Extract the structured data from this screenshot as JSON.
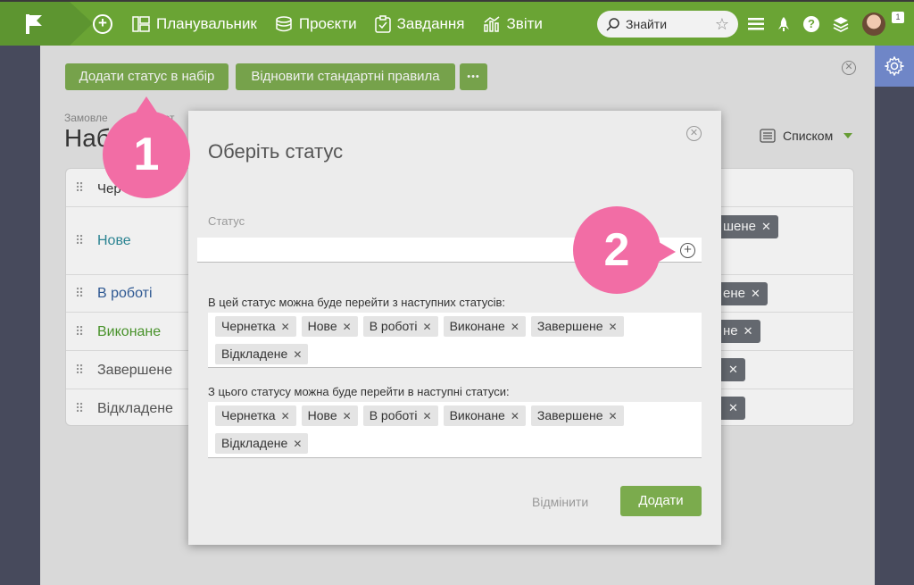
{
  "topbar": {
    "nav": [
      {
        "label": "Планувальник",
        "icon": "planner-icon"
      },
      {
        "label": "Проєкти",
        "icon": "projects-icon"
      },
      {
        "label": "Завдання",
        "icon": "tasks-icon"
      },
      {
        "label": "Звіти",
        "icon": "reports-icon"
      }
    ],
    "search_label": "Знайти",
    "notification_count": "1"
  },
  "panel": {
    "add_status_button": "Додати статус в набір",
    "restore_button": "Відновити стандартні правила",
    "more_button": "•••",
    "breadcrumb": "Замовле",
    "breadcrumb_tail": "от",
    "title": "Наб",
    "view_label": "Списком",
    "table_header": "Чер",
    "rows": [
      {
        "name": "Нове",
        "color": "#2a8a9a",
        "tag": "шене"
      },
      {
        "name": "В роботі",
        "color": "#2d5b9a",
        "tag": "ене"
      },
      {
        "name": "Виконане",
        "color": "#4a9a2a",
        "tag": "не"
      },
      {
        "name": "Завершене",
        "color": "#555555",
        "tag": ""
      },
      {
        "name": "Відкладене",
        "color": "#555555",
        "tag": ""
      }
    ]
  },
  "modal": {
    "title": "Оберіть статус",
    "status_label": "Статус",
    "status_value": "",
    "from_label": "В цей статус можна буде перейти з наступних статусів:",
    "from_tags": [
      "Чернетка",
      "Нове",
      "В роботі",
      "Виконане",
      "Завершене",
      "Відкладене"
    ],
    "to_label": "З цього статусу можна буде перейти в наступні статуси:",
    "to_tags": [
      "Чернетка",
      "Нове",
      "В роботі",
      "Виконане",
      "Завершене",
      "Відкладене"
    ],
    "cancel_label": "Відмінити",
    "add_label": "Додати"
  },
  "callouts": {
    "first": "1",
    "second": "2"
  },
  "colors": {
    "brand_green": "#6aa434",
    "button_green": "#7bab4d",
    "callout_pink": "#f26da5",
    "gear_blue": "#6f86c7"
  }
}
